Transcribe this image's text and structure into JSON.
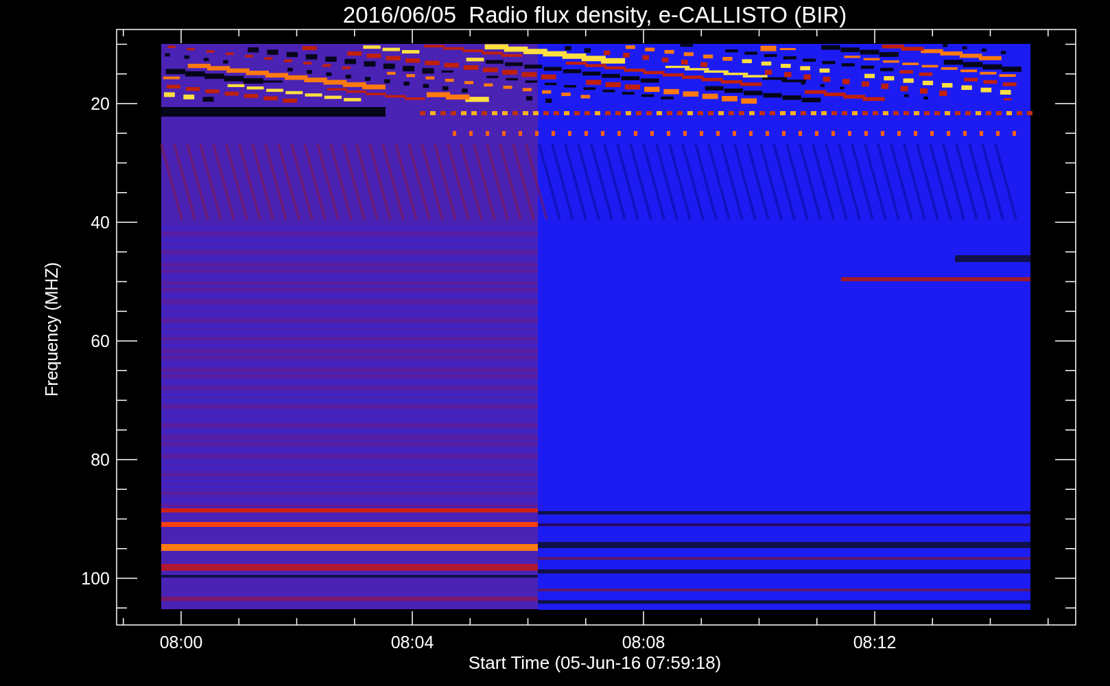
{
  "plot": {
    "title": "2016/06/05  Radio flux density, e-CALLISTO (BIR)",
    "ylabel": "Frequency (MHZ)",
    "xlabel": "Start Time (05-Jun-16 07:59:18)",
    "xticks": [
      "08:00",
      "08:04",
      "08:08",
      "08:12"
    ],
    "yticks": [
      "20",
      "40",
      "60",
      "80",
      "100"
    ]
  }
}
